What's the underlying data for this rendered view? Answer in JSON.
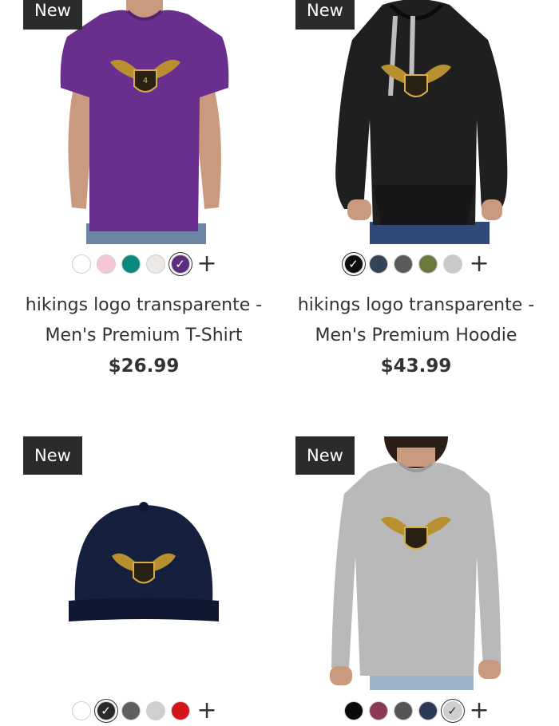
{
  "products": [
    {
      "badge": "New",
      "title_line1": "hikings logo transparente -",
      "title_line2": "Men's Premium T-Shirt",
      "price": "$26.99",
      "garment_color": "#6a2f8e",
      "swatches": [
        {
          "color": "#ffffff",
          "selected": false
        },
        {
          "color": "#f4c6d6",
          "selected": false
        },
        {
          "color": "#0b8a80",
          "selected": false
        },
        {
          "color": "#ece9e6",
          "selected": false
        },
        {
          "color": "#5b2d7c",
          "selected": true
        }
      ],
      "more_colors": "+"
    },
    {
      "badge": "New",
      "title_line1": "hikings logo transparente -",
      "title_line2": "Men's Premium Hoodie",
      "price": "$43.99",
      "garment_color": "#1f1f1f",
      "swatches": [
        {
          "color": "#0d0d0d",
          "selected": true
        },
        {
          "color": "#344457",
          "selected": false
        },
        {
          "color": "#5a5a5a",
          "selected": false
        },
        {
          "color": "#6b7a3c",
          "selected": false
        },
        {
          "color": "#c9c9c9",
          "selected": false
        }
      ],
      "more_colors": "+"
    },
    {
      "badge": "New",
      "garment_color": "#14203d",
      "swatches": [
        {
          "color": "#ffffff",
          "selected": false
        },
        {
          "color": "#2a2a2a",
          "selected": true
        },
        {
          "color": "#5f5f5f",
          "selected": false
        },
        {
          "color": "#cfcfcf",
          "selected": false
        },
        {
          "color": "#d4141c",
          "selected": false
        }
      ],
      "more_colors": "+"
    },
    {
      "badge": "New",
      "garment_color": "#b9b9b9",
      "swatches": [
        {
          "color": "#0a0a0a",
          "selected": false
        },
        {
          "color": "#8a3a55",
          "selected": false
        },
        {
          "color": "#555555",
          "selected": false
        },
        {
          "color": "#2c3a55",
          "selected": false
        },
        {
          "color": "#cfcfcf",
          "selected": true
        }
      ],
      "more_colors": "+"
    }
  ],
  "check_glyph": "✓"
}
